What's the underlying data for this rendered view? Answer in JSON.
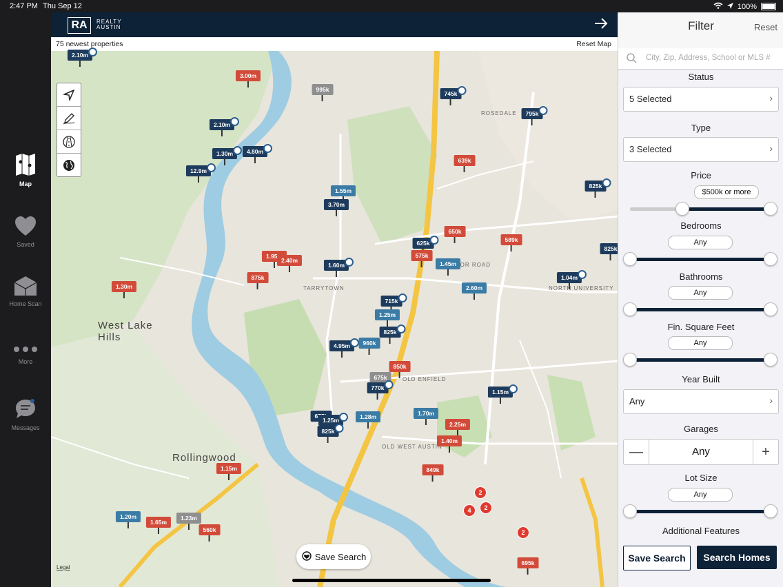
{
  "status_bar": {
    "time": "2:47 PM",
    "date": "Thu Sep 12",
    "battery": "100%"
  },
  "sidebar": {
    "items": [
      {
        "label": "Map",
        "icon": "map-icon",
        "active": true
      },
      {
        "label": "Saved",
        "icon": "heart-icon"
      },
      {
        "label": "Home Scan",
        "icon": "house-icon"
      },
      {
        "label": "More",
        "icon": "more-dots-icon"
      },
      {
        "label": "Messages",
        "icon": "chat-bubble-icon"
      }
    ]
  },
  "header": {
    "logo": "RA",
    "brand_line1": "REALTY",
    "brand_line2": "AUSTIN"
  },
  "map": {
    "count_text": "75 newest properties",
    "reset_label": "Reset Map",
    "save_search_label": "Save Search",
    "legal": "Legal",
    "area_labels": [
      "West Lake Hills",
      "Rollingwood",
      "TARRYTOWN",
      "ROSEDALE",
      "WINDSOR ROAD",
      "OLD ENFIELD",
      "OLD WEST AUSTIN",
      "NORTH UNIVERSITY"
    ],
    "pins": [
      {
        "label": "2.10m",
        "c": "navy",
        "dot": true
      },
      {
        "label": "3.00m",
        "c": "red"
      },
      {
        "label": "995k",
        "c": "gray"
      },
      {
        "label": "745k",
        "c": "navy",
        "dot": true
      },
      {
        "label": "795k",
        "c": "navy",
        "dot": true
      },
      {
        "label": "2.10m",
        "c": "navy",
        "dot": true
      },
      {
        "label": "1.30m",
        "c": "navy",
        "dot": true
      },
      {
        "label": "4.80m",
        "c": "navy",
        "dot": true
      },
      {
        "label": "12.9m",
        "c": "navy",
        "dot": true
      },
      {
        "label": "639k",
        "c": "red"
      },
      {
        "label": "825k",
        "c": "navy",
        "dot": true
      },
      {
        "label": "1.55m",
        "c": "teal"
      },
      {
        "label": "3.70m",
        "c": "navy"
      },
      {
        "label": "650k",
        "c": "red"
      },
      {
        "label": "625k",
        "c": "navy",
        "dot": true
      },
      {
        "label": "589k",
        "c": "red"
      },
      {
        "label": "575k",
        "c": "red"
      },
      {
        "label": "1.95m",
        "c": "red"
      },
      {
        "label": "2.40m",
        "c": "red"
      },
      {
        "label": "1.60m",
        "c": "navy",
        "dot": true
      },
      {
        "label": "1.45m",
        "c": "teal"
      },
      {
        "label": "825k",
        "c": "navy"
      },
      {
        "label": "875k",
        "c": "red"
      },
      {
        "label": "2.60m",
        "c": "teal"
      },
      {
        "label": "1.04m",
        "c": "navy",
        "dot": true
      },
      {
        "label": "1.30m",
        "c": "red"
      },
      {
        "label": "715k",
        "c": "navy",
        "dot": true
      },
      {
        "label": "1.25m",
        "c": "teal"
      },
      {
        "label": "825k",
        "c": "navy",
        "dot": true
      },
      {
        "label": "4.95m",
        "c": "navy",
        "dot": true
      },
      {
        "label": "960k",
        "c": "teal"
      },
      {
        "label": "850k",
        "c": "red"
      },
      {
        "label": "675k",
        "c": "gray"
      },
      {
        "label": "770k",
        "c": "navy",
        "dot": true
      },
      {
        "label": "1.15m",
        "c": "navy",
        "dot": true
      },
      {
        "label": "675k",
        "c": "navy"
      },
      {
        "label": "1.25m",
        "c": "navy",
        "dot": true
      },
      {
        "label": "825k",
        "c": "navy",
        "dot": true
      },
      {
        "label": "1.28m",
        "c": "teal"
      },
      {
        "label": "1.70m",
        "c": "teal"
      },
      {
        "label": "2.25m",
        "c": "red"
      },
      {
        "label": "1.40m",
        "c": "red"
      },
      {
        "label": "1.15m",
        "c": "red"
      },
      {
        "label": "849k",
        "c": "red"
      },
      {
        "label": "1.20m",
        "c": "teal"
      },
      {
        "label": "1.65m",
        "c": "red"
      },
      {
        "label": "1.23m",
        "c": "gray"
      },
      {
        "label": "560k",
        "c": "red"
      },
      {
        "label": "695k",
        "c": "red"
      }
    ],
    "clusters": [
      "2",
      "4",
      "2",
      "2"
    ]
  },
  "filter": {
    "title": "Filter",
    "reset": "Reset",
    "search_placeholder": "City, Zip, Address, School or MLS #",
    "status": {
      "label": "Status",
      "value": "5 Selected"
    },
    "type": {
      "label": "Type",
      "value": "3 Selected"
    },
    "price": {
      "label": "Price",
      "value": "$500k or more"
    },
    "bedrooms": {
      "label": "Bedrooms",
      "value": "Any"
    },
    "bathrooms": {
      "label": "Bathrooms",
      "value": "Any"
    },
    "sqft": {
      "label": "Fin. Square Feet",
      "value": "Any"
    },
    "year_built": {
      "label": "Year Built",
      "value": "Any"
    },
    "garages": {
      "label": "Garages",
      "value": "Any",
      "minus": "—",
      "plus": "+"
    },
    "lot_size": {
      "label": "Lot Size",
      "value": "Any"
    },
    "additional": "Additional Features",
    "save_search": "Save Search",
    "search_homes": "Search Homes"
  }
}
